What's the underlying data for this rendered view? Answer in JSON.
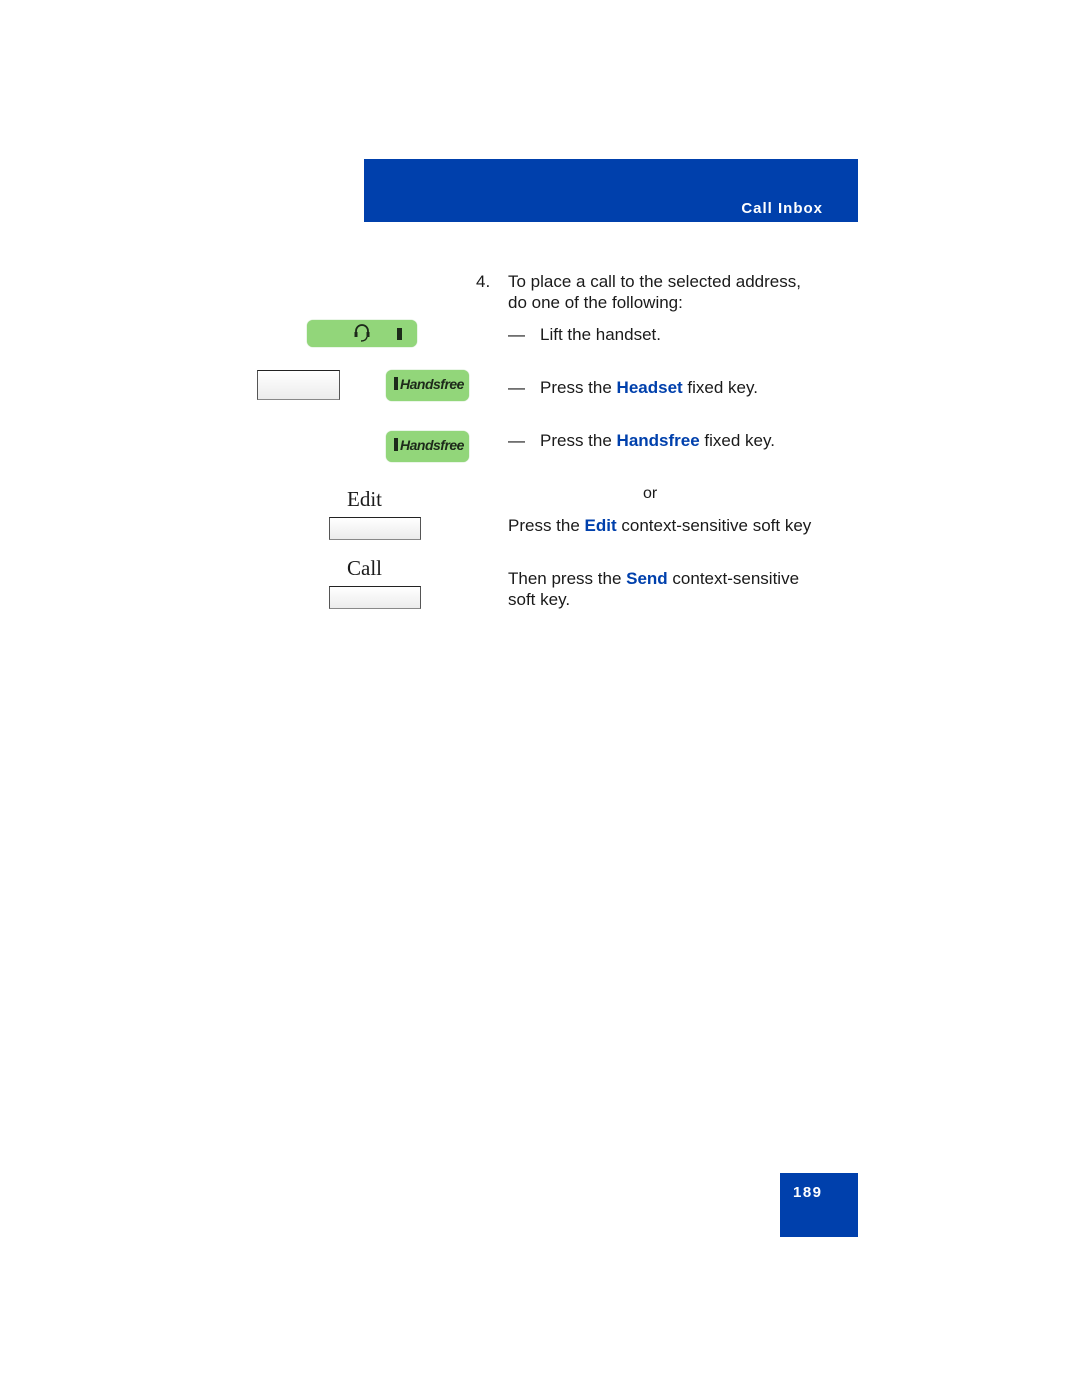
{
  "header": {
    "title": "Call Inbox"
  },
  "step": {
    "number": "4.",
    "line1": "To place a call to the selected address,",
    "line2": "do one of the following:"
  },
  "options": [
    {
      "dash": "—",
      "pre": "Lift the handset.",
      "key": "",
      "post": ""
    },
    {
      "dash": "—",
      "pre": "Press the ",
      "key": "Headset",
      "post": " fixed key."
    },
    {
      "dash": "—",
      "pre": "Press the ",
      "key": "Handsfree",
      "post": " fixed key."
    }
  ],
  "or_text": "or",
  "edit_instruction": {
    "pre": "Press the ",
    "key": "Edit",
    "post": " context-sensitive soft key"
  },
  "send_instruction": {
    "pre": "Then press the ",
    "key": "Send",
    "post": " context-sensitive",
    "line2": "soft key."
  },
  "keys": {
    "handsfree_label": "Handsfree",
    "edit_label": "Edit",
    "call_label": "Call"
  },
  "colors": {
    "brand_blue": "#0040ac",
    "key_green": "#92d67a"
  },
  "page_number": "189"
}
